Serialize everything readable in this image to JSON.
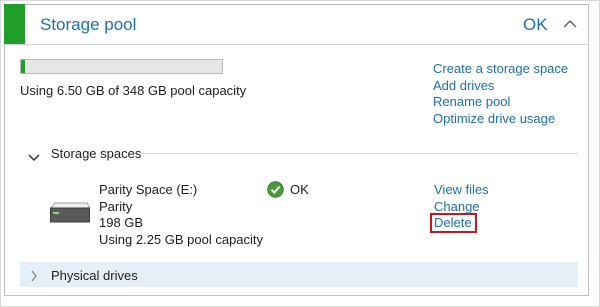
{
  "pool": {
    "title": "Storage pool",
    "status": "OK",
    "usage_fraction": 0.019,
    "usage_text": "Using 6.50 GB of 348 GB pool capacity",
    "links": [
      "Create a storage space",
      "Add drives",
      "Rename pool",
      "Optimize drive usage"
    ]
  },
  "storage_spaces": {
    "heading": "Storage spaces",
    "space": {
      "name": "Parity Space (E:)",
      "type": "Parity",
      "size": "198 GB",
      "usage": "Using 2.25 GB pool capacity",
      "status": "OK",
      "links": {
        "view_files": "View files",
        "change": "Change",
        "delete": "Delete"
      }
    }
  },
  "physical_drives": {
    "heading": "Physical drives"
  },
  "colors": {
    "accent": "#1f9f29",
    "link": "#1f6fad",
    "highlight_box": "#d0121b",
    "section_band": "#e5eff8"
  },
  "icons": [
    "chevron-up-icon",
    "chevron-down-icon",
    "chevron-right-icon",
    "drive-icon",
    "ok-checkmark-icon"
  ]
}
